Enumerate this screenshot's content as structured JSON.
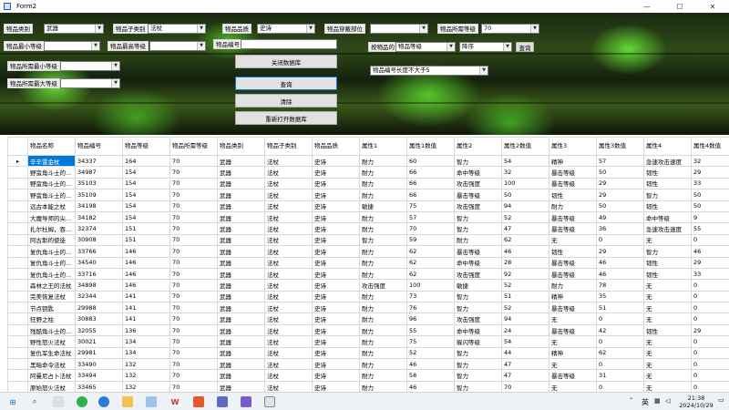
{
  "window": {
    "title": "Form2",
    "minimize": "—",
    "maximize": "☐",
    "close": "✕"
  },
  "controls": {
    "category_label": "物品类别",
    "category_value": "武器",
    "subcategory_label": "物品子类别",
    "subcategory_value": "法杖",
    "quality_label": "物品品质",
    "quality_value": "史诗",
    "slot_label": "物品穿戴部位",
    "slot_value": "",
    "req_level_label": "物品所需等级",
    "req_level_value": "70",
    "min_level_label": "物品最小等级",
    "min_level_value": "",
    "max_level_label": "物品最高等级",
    "max_level_value": "",
    "id_label": "物品编号",
    "id_value": "",
    "sort_label": "按物品的",
    "sort_field_value": "物品等级",
    "sort_order_value": "降序",
    "query_small": "查询",
    "req_min_label": "物品所需最小等级",
    "req_min_value": "",
    "req_max_label": "物品所需最大等级",
    "req_max_value": "",
    "id_length_value": "物品编号长度不大于5",
    "btn_close_db": "关闭数据库",
    "btn_query": "查询",
    "btn_clear": "清除",
    "btn_reopen_db": "重新打开数据库"
  },
  "grid": {
    "row_marker": "▸",
    "columns": [
      "物品名称",
      "物品编号",
      "物品等级",
      "物品所需等级",
      "物品类别",
      "物品子类别",
      "物品品质",
      "属性1",
      "属性1数值",
      "属性2",
      "属性2数值",
      "属性3",
      "属性3数值",
      "属性4",
      "属性4数值"
    ],
    "rows": [
      [
        "辛辛雷金杖",
        "34337",
        "164",
        "70",
        "武器",
        "法杖",
        "史诗",
        "耐力",
        "60",
        "智力",
        "54",
        "精神",
        "57",
        "急速攻击速度",
        "32"
      ],
      [
        "野蛮角斗士的...",
        "34987",
        "154",
        "70",
        "武器",
        "法杖",
        "史诗",
        "耐力",
        "66",
        "命中等级",
        "32",
        "暴击等级",
        "50",
        "韧性",
        "29"
      ],
      [
        "野蛮角斗士的...",
        "35103",
        "154",
        "70",
        "武器",
        "法杖",
        "史诗",
        "耐力",
        "66",
        "攻击强度",
        "100",
        "暴击等级",
        "29",
        "韧性",
        "33"
      ],
      [
        "野蛮角斗士的...",
        "35109",
        "154",
        "70",
        "武器",
        "法杖",
        "史诗",
        "耐力",
        "66",
        "暴击等级",
        "50",
        "韧性",
        "29",
        "智力",
        "50"
      ],
      [
        "远古本能之杖",
        "34198",
        "154",
        "70",
        "武器",
        "法杖",
        "史诗",
        "敏捷",
        "75",
        "攻击强度",
        "94",
        "耐力",
        "50",
        "韧性",
        "50"
      ],
      [
        "大魔导师的尖...",
        "34182",
        "154",
        "70",
        "武器",
        "法杖",
        "史诗",
        "耐力",
        "57",
        "智力",
        "52",
        "暴击等级",
        "49",
        "命中等级",
        "9"
      ],
      [
        "扎尔杜姆，吞...",
        "32374",
        "151",
        "70",
        "武器",
        "法杖",
        "史诗",
        "耐力",
        "70",
        "智力",
        "47",
        "暴击等级",
        "36",
        "急速攻击速度",
        "55"
      ],
      [
        "阿古斯的使徒",
        "30908",
        "151",
        "70",
        "武器",
        "法杖",
        "史诗",
        "智力",
        "59",
        "耐力",
        "62",
        "无",
        "0",
        "无",
        "0"
      ],
      [
        "复仇角斗士的...",
        "33766",
        "146",
        "70",
        "武器",
        "法杖",
        "史诗",
        "耐力",
        "62",
        "暴击等级",
        "46",
        "韧性",
        "29",
        "智力",
        "46"
      ],
      [
        "复仇角斗士的...",
        "34540",
        "146",
        "70",
        "武器",
        "法杖",
        "史诗",
        "耐力",
        "62",
        "命中等级",
        "28",
        "暴击等级",
        "46",
        "韧性",
        "29"
      ],
      [
        "复仇角斗士的...",
        "33716",
        "146",
        "70",
        "武器",
        "法杖",
        "史诗",
        "耐力",
        "62",
        "攻击强度",
        "92",
        "暴击等级",
        "46",
        "韧性",
        "33"
      ],
      [
        "森林之王的法杖",
        "34898",
        "146",
        "70",
        "武器",
        "法杖",
        "史诗",
        "攻击强度",
        "100",
        "敏捷",
        "52",
        "耐力",
        "78",
        "无",
        "0"
      ],
      [
        "完美恢复法杖",
        "32344",
        "141",
        "70",
        "武器",
        "法杖",
        "史诗",
        "耐力",
        "73",
        "智力",
        "51",
        "精神",
        "35",
        "无",
        "0"
      ],
      [
        "节点钥匙",
        "29988",
        "141",
        "70",
        "武器",
        "法杖",
        "史诗",
        "耐力",
        "76",
        "智力",
        "52",
        "暴击等级",
        "51",
        "无",
        "0"
      ],
      [
        "狂野之柱",
        "30883",
        "141",
        "70",
        "武器",
        "法杖",
        "史诗",
        "耐力",
        "96",
        "攻击强度",
        "94",
        "无",
        "0",
        "无",
        "0"
      ],
      [
        "残酷角斗士的...",
        "32055",
        "136",
        "70",
        "武器",
        "法杖",
        "史诗",
        "耐力",
        "55",
        "命中等级",
        "24",
        "暴击等级",
        "42",
        "韧性",
        "29"
      ],
      [
        "野性怒火法杖",
        "30021",
        "134",
        "70",
        "武器",
        "法杖",
        "史诗",
        "耐力",
        "75",
        "躲闪等级",
        "54",
        "无",
        "0",
        "无",
        "0"
      ],
      [
        "复仇军生命法杖",
        "29981",
        "134",
        "70",
        "武器",
        "法杖",
        "史诗",
        "耐力",
        "52",
        "智力",
        "44",
        "精神",
        "62",
        "无",
        "0"
      ],
      [
        "黑暗命令法杖",
        "33490",
        "132",
        "70",
        "武器",
        "法杖",
        "史诗",
        "耐力",
        "46",
        "智力",
        "47",
        "无",
        "0",
        "无",
        "0"
      ],
      [
        "阿曼尼占卜法杖",
        "33494",
        "132",
        "70",
        "武器",
        "法杖",
        "史诗",
        "耐力",
        "58",
        "智力",
        "47",
        "暴击等级",
        "31",
        "无",
        "0"
      ],
      [
        "原始怒火法杖",
        "33465",
        "132",
        "70",
        "武器",
        "法杖",
        "史诗",
        "耐力",
        "46",
        "智力",
        "70",
        "无",
        "0",
        "无",
        "0"
      ]
    ]
  },
  "taskbar": {
    "search_icon": "⌕",
    "lang": "英",
    "time": "21:38",
    "date": "2024/10/29"
  }
}
